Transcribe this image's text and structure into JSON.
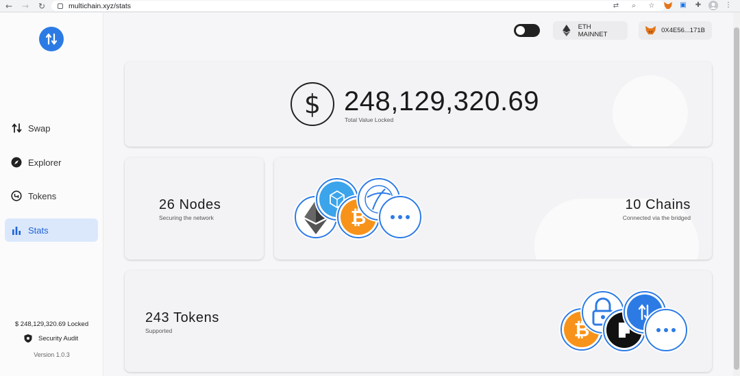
{
  "browser": {
    "url": "multichain.xyz/stats"
  },
  "sidebar": {
    "items": [
      {
        "label": "Swap"
      },
      {
        "label": "Explorer"
      },
      {
        "label": "Tokens"
      },
      {
        "label": "Stats"
      }
    ],
    "locked_text": "$ 248,129,320.69 Locked",
    "audit_label": "Security Audit",
    "version": "Version 1.0.3"
  },
  "header": {
    "network_label": "ETH MAINNET",
    "wallet_address": "0X4E56...171B"
  },
  "tvl": {
    "currency_symbol": "$",
    "value": "248,129,320.69",
    "label": "Total Value Locked"
  },
  "nodes": {
    "value": "26 Nodes",
    "label": "Securing the network"
  },
  "chains": {
    "value": "10 Chains",
    "label": "Connected via the bridged"
  },
  "tokens": {
    "value": "243 Tokens",
    "label": "Supported"
  },
  "colors": {
    "accent": "#2c7be5",
    "active_bg": "#dbe8fc",
    "bitcoin": "#f7931a",
    "fantom": "#1969ff"
  },
  "icons": {
    "chain_coins": [
      "ethereum-icon",
      "fantom-icon",
      "bitcoin-icon",
      "harmony-icon",
      "more-icon"
    ],
    "token_coins": [
      "bitcoin-icon",
      "lock-token-icon",
      "dark-token-icon",
      "any-token-icon",
      "more-icon"
    ]
  }
}
